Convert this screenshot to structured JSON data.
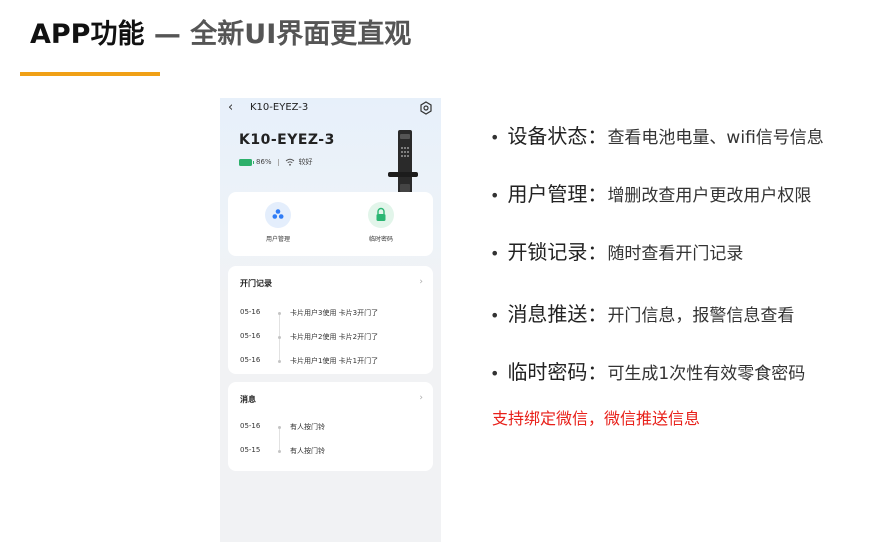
{
  "slide": {
    "title_bold": "APP功能",
    "title_rest": " — 全新UI界面更直观"
  },
  "app": {
    "nav_title": "K10-EYEZ-3",
    "device_name": "K10-EYEZ-3",
    "battery": "86%",
    "wifi_status": "较好",
    "functions": [
      {
        "label": "用户管理",
        "icon": "users-icon",
        "color": "#2f7cf6"
      },
      {
        "label": "临时密码",
        "icon": "lock-icon",
        "color": "#2bb673"
      }
    ],
    "records": {
      "title": "开门记录",
      "items": [
        {
          "date": "05-16",
          "text": "卡片用户3使用 卡片3开门了"
        },
        {
          "date": "05-16",
          "text": "卡片用户2使用 卡片2开门了"
        },
        {
          "date": "05-16",
          "text": "卡片用户1使用 卡片1开门了"
        }
      ]
    },
    "messages": {
      "title": "消息",
      "items": [
        {
          "date": "05-16",
          "text": "有人按门铃"
        },
        {
          "date": "05-15",
          "text": "有人按门铃"
        }
      ]
    }
  },
  "features": [
    {
      "label": "设备状态：",
      "desc": "查看电池电量、wifi信号信息"
    },
    {
      "label": "用户管理：",
      "desc": "增删改查用户更改用户权限"
    },
    {
      "label": "开锁记录：",
      "desc": "随时查看开门记录"
    },
    {
      "label": "消息推送：",
      "desc": "开门信息，报警信息查看"
    },
    {
      "label": "临时密码：",
      "desc": "可生成1次性有效零食密码"
    }
  ],
  "note": "支持绑定微信，微信推送信息",
  "colors": {
    "accent": "#f0a016",
    "note": "#e8201a",
    "battery": "#2db06b"
  }
}
